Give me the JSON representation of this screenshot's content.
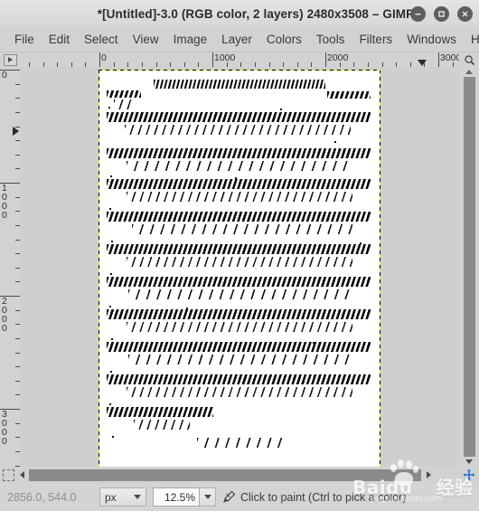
{
  "window": {
    "title": "*[Untitled]-3.0 (RGB color, 2 layers) 2480x3508 – GIMP",
    "buttons": [
      {
        "name": "minimize",
        "glyph": "–"
      },
      {
        "name": "maximize",
        "glyph": "□"
      },
      {
        "name": "close",
        "glyph": "×"
      }
    ]
  },
  "menubar": {
    "items": [
      {
        "label": "File"
      },
      {
        "label": "Edit"
      },
      {
        "label": "Select"
      },
      {
        "label": "View"
      },
      {
        "label": "Image"
      },
      {
        "label": "Layer"
      },
      {
        "label": "Colors"
      },
      {
        "label": "Tools"
      },
      {
        "label": "Filters"
      },
      {
        "label": "Windows"
      },
      {
        "label": "Help"
      }
    ]
  },
  "rulers": {
    "corner_icon": "ruler-menu-icon",
    "zoom_icon": "zoom-image-icon",
    "unit": "px",
    "horizontal": {
      "labels": [
        "0",
        "1000",
        "2000",
        "3000"
      ],
      "marker_value": "2856"
    },
    "vertical": {
      "labels": [
        "0",
        "1000",
        "2000",
        "3000"
      ],
      "marker_value": "544"
    }
  },
  "canvas": {
    "image_width": "2480",
    "image_height": "3508",
    "layer_boundary_colors": [
      "#f2e52b",
      "#000000"
    ],
    "page_background": "#ffffff",
    "surround_background": "#cfcfcf",
    "content_description": "scanned-document-sheared-text"
  },
  "scrollbars": {
    "vertical": {
      "thumb_color": "#8a8a8a",
      "track_color": "#d2d2d2"
    },
    "horizontal": {
      "thumb_color": "#8a8a8a",
      "track_color": "#d2d2d2"
    },
    "quick_mask_icon": "quick-mask-icon",
    "navigation_icon": "navigate-image-icon"
  },
  "statusbar": {
    "pointer_position": "2856.0, 544.0",
    "unit_selector": {
      "value": "px"
    },
    "zoom": {
      "value": "12.5%"
    },
    "tool_icon": "paintbrush-icon",
    "hint": "Click to paint (Ctrl to pick a color)"
  },
  "watermark": {
    "brand": "Baidu",
    "brand_cn": "经验",
    "sub": "jingyan.baidu.com"
  }
}
